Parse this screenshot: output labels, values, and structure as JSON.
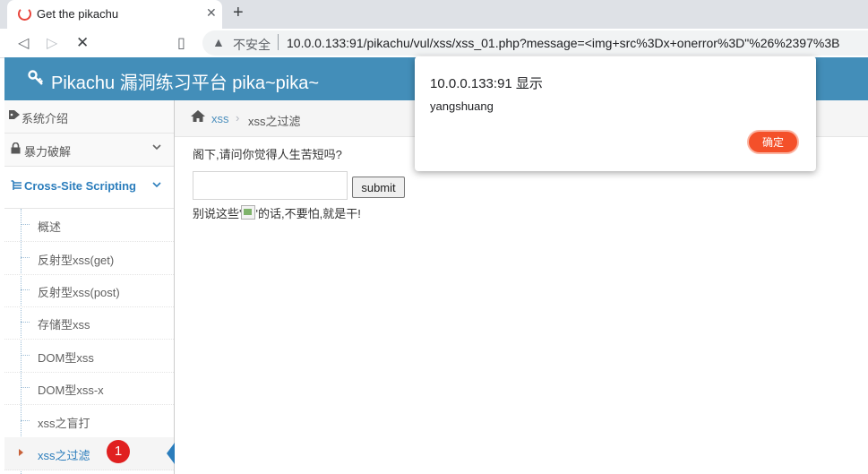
{
  "browser": {
    "tab_title": "Get the pikachu",
    "tab_close": "✕",
    "new_tab": "+",
    "back": "◁",
    "forward": "▷",
    "stop": "✕",
    "bookmark": "▯",
    "warning": "▲",
    "insecure_label": "不安全",
    "url": "10.0.0.133:91/pikachu/vul/xss/xss_01.php?message=<img+src%3Dx+onerror%3D\"%26%2397%3B"
  },
  "header": {
    "title": "Pikachu 漏洞练习平台 pika~pika~"
  },
  "sidebar": {
    "items": [
      {
        "label": "系统介绍",
        "icon": "tag-icon"
      },
      {
        "label": "暴力破解",
        "icon": "lock-icon",
        "chevron": "⌄"
      },
      {
        "label": "Cross-Site Scripting",
        "icon": "list-icon",
        "chevron": "⌄"
      }
    ],
    "sub_items": [
      {
        "label": "概述"
      },
      {
        "label": "反射型xss(get)"
      },
      {
        "label": "反射型xss(post)"
      },
      {
        "label": "存储型xss"
      },
      {
        "label": "DOM型xss"
      },
      {
        "label": "DOM型xss-x"
      },
      {
        "label": "xss之盲打"
      },
      {
        "label": "xss之过滤"
      }
    ],
    "badge": "1"
  },
  "breadcrumb": {
    "item1": "xss",
    "sep": "›",
    "item2": "xss之过滤"
  },
  "main": {
    "question": "阁下,请问你觉得人生苦短吗?",
    "input_value": "",
    "submit_label": "submit",
    "result_prefix": "别说这些'",
    "result_suffix": "'的话,不要怕,就是干!"
  },
  "dialog": {
    "title": "10.0.0.133:91 显示",
    "message": "yangshuang",
    "ok_label": "确定"
  },
  "colors": {
    "header": "#438eb9",
    "accent": "#2b7dbc",
    "ok_button": "#f4502a",
    "badge": "#e02020"
  }
}
